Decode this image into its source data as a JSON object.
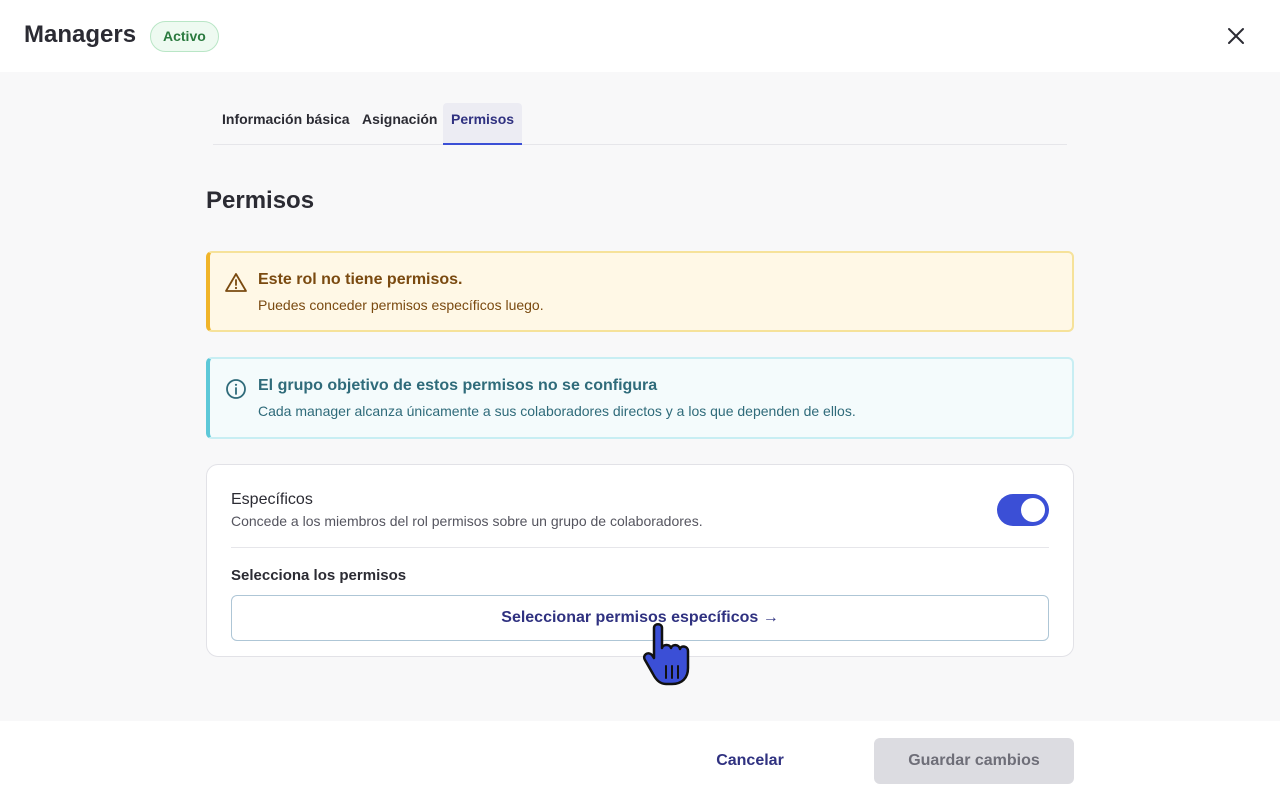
{
  "header": {
    "title": "Managers",
    "status_badge": "Activo",
    "close_icon": "close-icon"
  },
  "tabs": [
    {
      "label": "Información básica",
      "active": false
    },
    {
      "label": "Asignación",
      "active": false
    },
    {
      "label": "Permisos",
      "active": true
    }
  ],
  "section": {
    "title": "Permisos"
  },
  "alerts": {
    "warning": {
      "icon": "warning-triangle-icon",
      "title": "Este rol no tiene permisos.",
      "text": "Puedes conceder permisos específicos luego."
    },
    "info": {
      "icon": "info-circle-icon",
      "title": "El grupo objetivo de estos permisos no se configura",
      "text": "Cada manager alcanza únicamente a sus colaboradores directos y a los que dependen de ellos."
    }
  },
  "specific_card": {
    "title": "Específicos",
    "description": "Concede a los miembros del rol permisos sobre un grupo de colaboradores.",
    "toggle_on": true,
    "select_label": "Selecciona los permisos",
    "select_button": "Seleccionar permisos específicos →"
  },
  "footer": {
    "cancel_label": "Cancelar",
    "save_label": "Guardar cambios"
  },
  "colors": {
    "accent": "#3b4fd6",
    "brand_text": "#2f3180",
    "warning_border": "#f0b429",
    "info_border": "#5dc8d8",
    "badge_green": "#2b7a3f"
  }
}
